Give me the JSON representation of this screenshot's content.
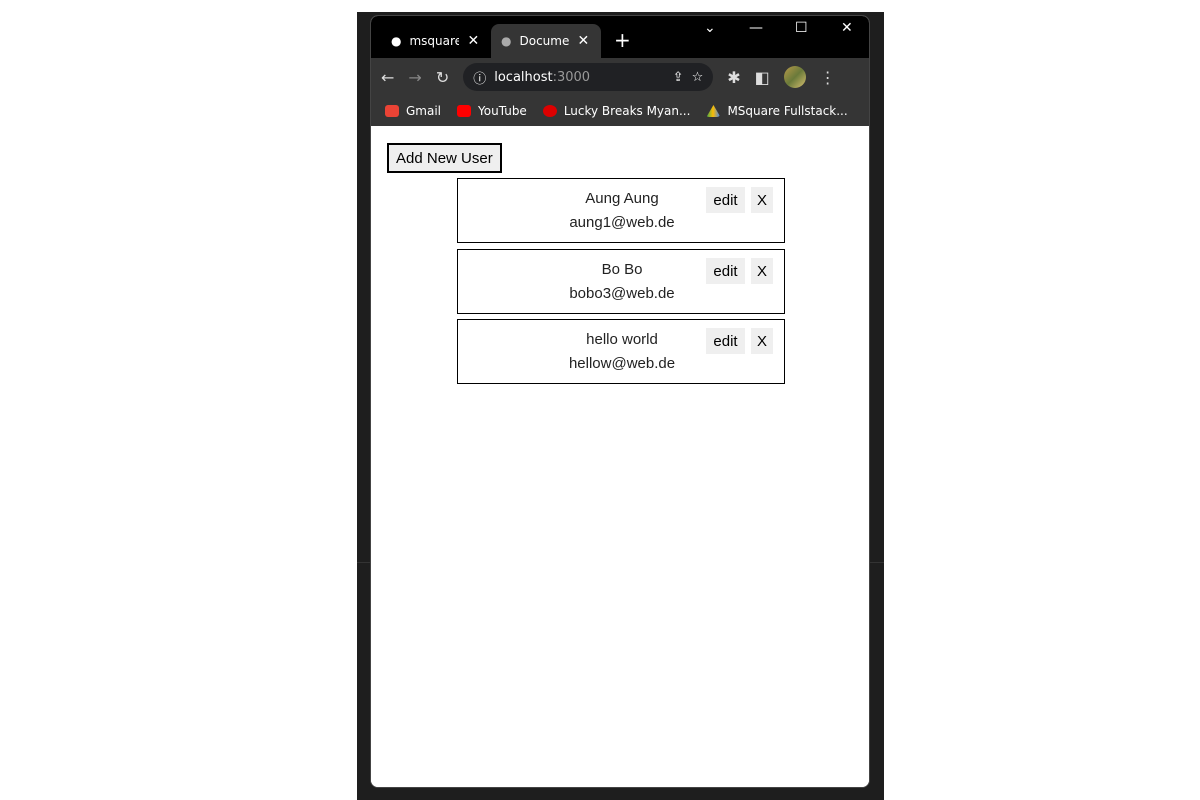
{
  "browser": {
    "tabs": [
      {
        "label": "msquare",
        "icon": "github-icon"
      },
      {
        "label": "Document",
        "icon": "globe-icon"
      }
    ],
    "new_tab": "+",
    "address": {
      "host": "localhost",
      "port": ":3000"
    },
    "bookmarks": [
      {
        "label": "Gmail"
      },
      {
        "label": "YouTube"
      },
      {
        "label": "Lucky Breaks Myan..."
      },
      {
        "label": "MSquare Fullstack..."
      }
    ]
  },
  "page": {
    "add_button": "Add New User",
    "users": [
      {
        "name": "Aung Aung",
        "email": "aung1@web.de"
      },
      {
        "name": "Bo Bo",
        "email": "bobo3@web.de"
      },
      {
        "name": "hello world",
        "email": "hellow@web.de"
      }
    ],
    "edit_label": "edit",
    "delete_label": "X"
  }
}
